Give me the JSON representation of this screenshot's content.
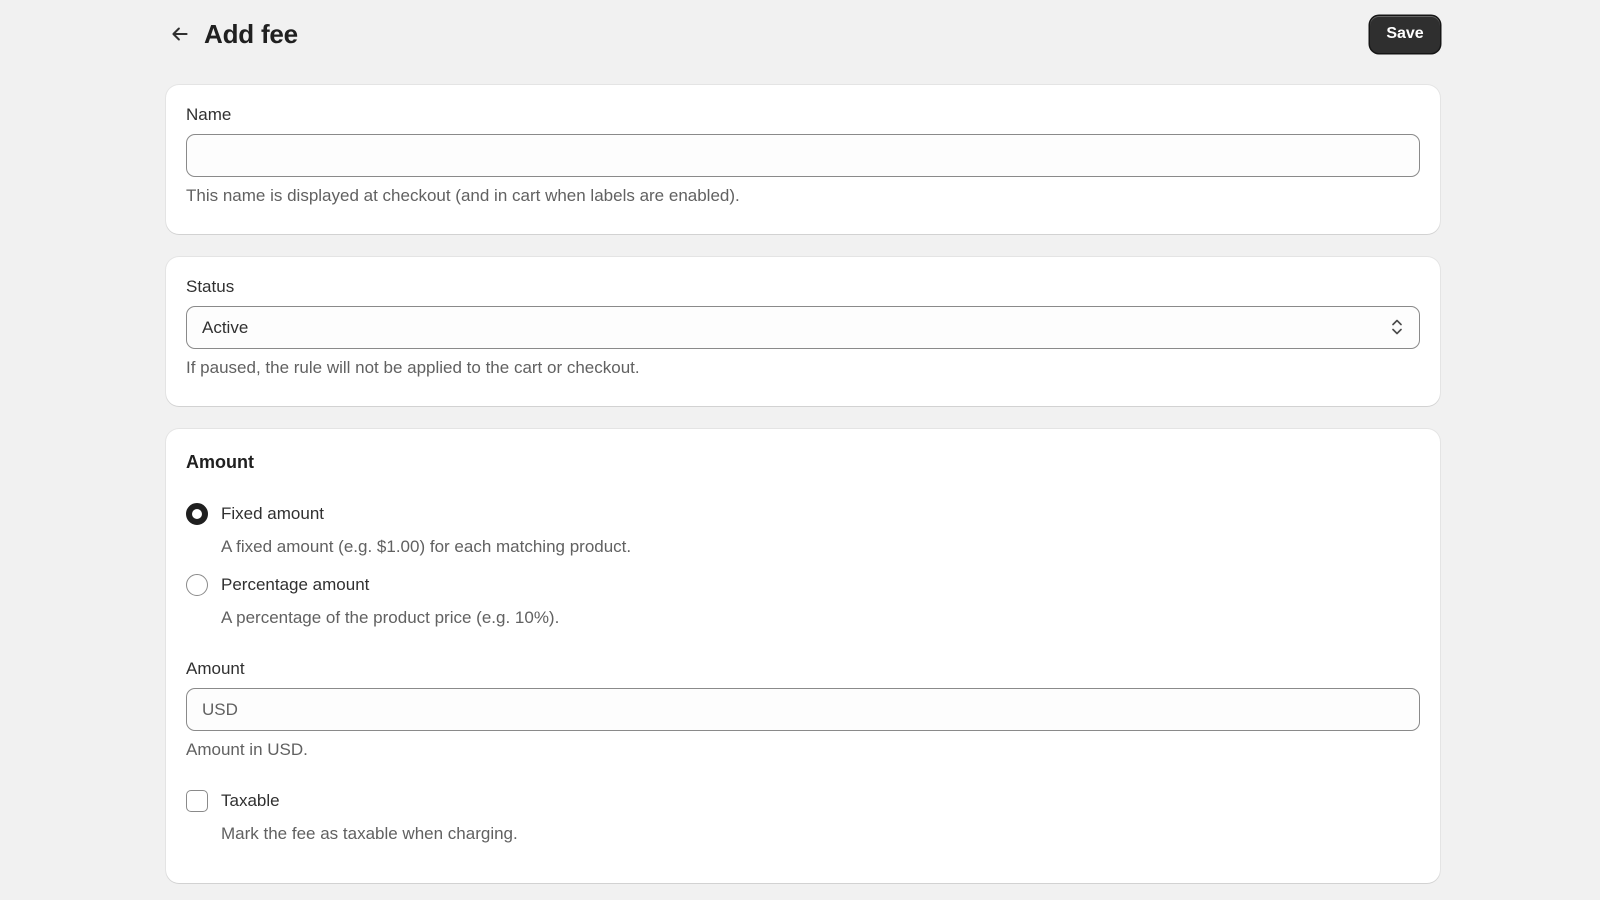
{
  "header": {
    "title": "Add fee",
    "save_label": "Save"
  },
  "name_section": {
    "label": "Name",
    "value": "",
    "help": "This name is displayed at checkout (and in cart when labels are enabled)."
  },
  "status_section": {
    "label": "Status",
    "selected": "Active",
    "help": "If paused, the rule will not be applied to the cart or checkout."
  },
  "amount_section": {
    "title": "Amount",
    "options": [
      {
        "label": "Fixed amount",
        "help": "A fixed amount (e.g. $1.00) for each matching product.",
        "checked": true
      },
      {
        "label": "Percentage amount",
        "help": "A percentage of the product price (e.g. 10%).",
        "checked": false
      }
    ],
    "amount_label": "Amount",
    "amount_placeholder": "USD",
    "amount_help": "Amount in USD.",
    "taxable_label": "Taxable",
    "taxable_help": "Mark the fee as taxable when charging.",
    "taxable_checked": false
  },
  "colors": {
    "background": "#f1f1f1",
    "card": "#ffffff",
    "primary_button": "#2f2f2f",
    "border": "#8a8a8a",
    "muted_text": "#616161"
  },
  "icons": {
    "back": "arrow-left-icon",
    "select": "chevron-up-down-icon"
  }
}
